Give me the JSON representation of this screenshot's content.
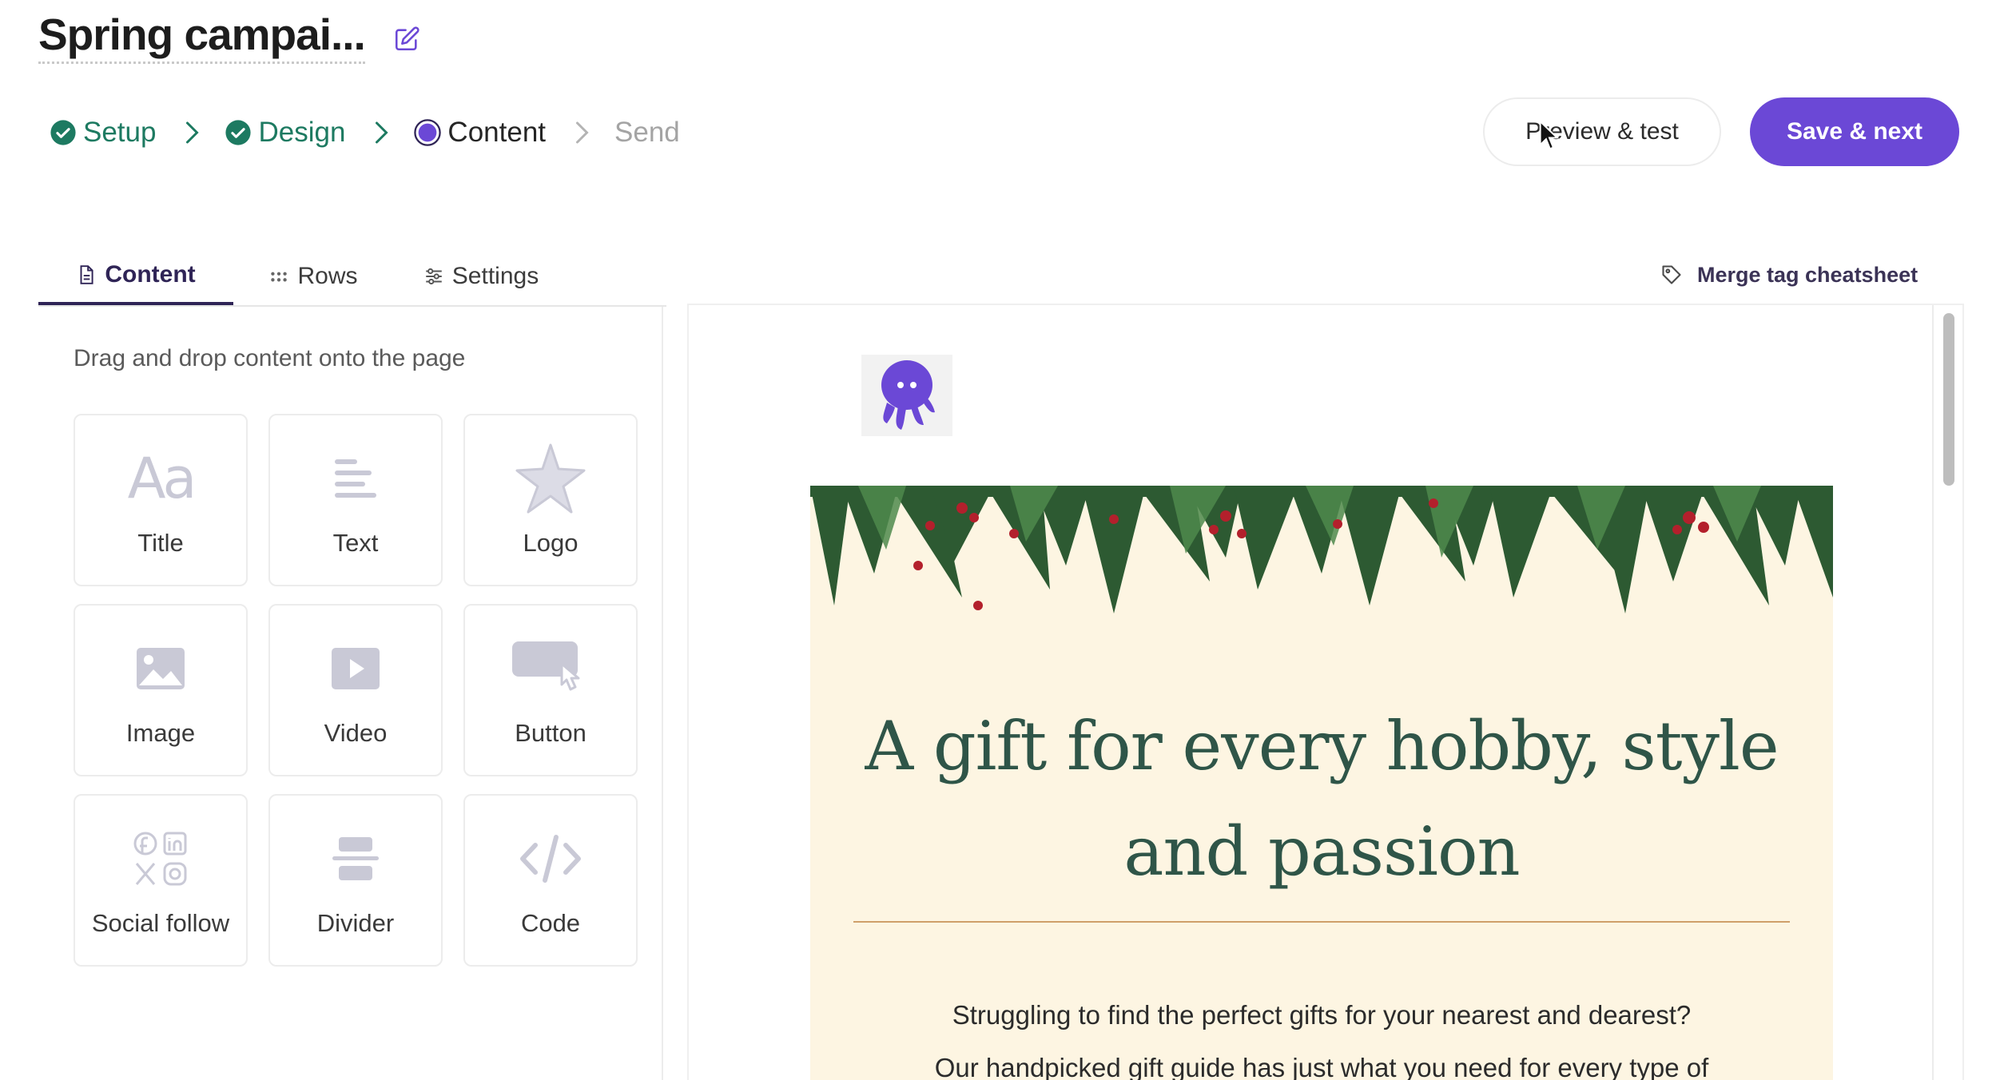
{
  "header": {
    "campaign_title": "Spring campai...",
    "edit_icon": "edit-pencil-icon"
  },
  "steps": [
    {
      "label": "Setup",
      "state": "done"
    },
    {
      "label": "Design",
      "state": "done"
    },
    {
      "label": "Content",
      "state": "current"
    },
    {
      "label": "Send",
      "state": "future"
    }
  ],
  "actions": {
    "preview_label": "Preview & test",
    "save_label": "Save & next"
  },
  "tabs": [
    {
      "label": "Content",
      "icon": "document-icon",
      "active": true
    },
    {
      "label": "Rows",
      "icon": "grid-dots-icon",
      "active": false
    },
    {
      "label": "Settings",
      "icon": "sliders-icon",
      "active": false
    }
  ],
  "merge_tag_link": "Merge tag cheatsheet",
  "panel": {
    "hint": "Drag and drop content onto the page",
    "blocks": [
      {
        "label": "Title",
        "icon": "title-aa-icon"
      },
      {
        "label": "Text",
        "icon": "text-lines-icon"
      },
      {
        "label": "Logo",
        "icon": "star-icon"
      },
      {
        "label": "Image",
        "icon": "image-icon"
      },
      {
        "label": "Video",
        "icon": "video-play-icon"
      },
      {
        "label": "Button",
        "icon": "button-pointer-icon"
      },
      {
        "label": "Social follow",
        "icon": "social-icons-icon"
      },
      {
        "label": "Divider",
        "icon": "divider-icon"
      },
      {
        "label": "Code",
        "icon": "code-icon"
      }
    ]
  },
  "email": {
    "logo_icon": "octopus-logo-icon",
    "headline": "A gift for every hobby, style and passion",
    "body_line_1": "Struggling to find the perfect gifts for your nearest and dearest?",
    "body_line_2": "Our handpicked gift guide has just what you need for every type of"
  },
  "colors": {
    "accent": "#6b48d6",
    "done_green": "#1d7a61",
    "email_bg": "#fdf5e2",
    "headline_green": "#2f5548",
    "rule_gold": "#cf9f6a"
  }
}
